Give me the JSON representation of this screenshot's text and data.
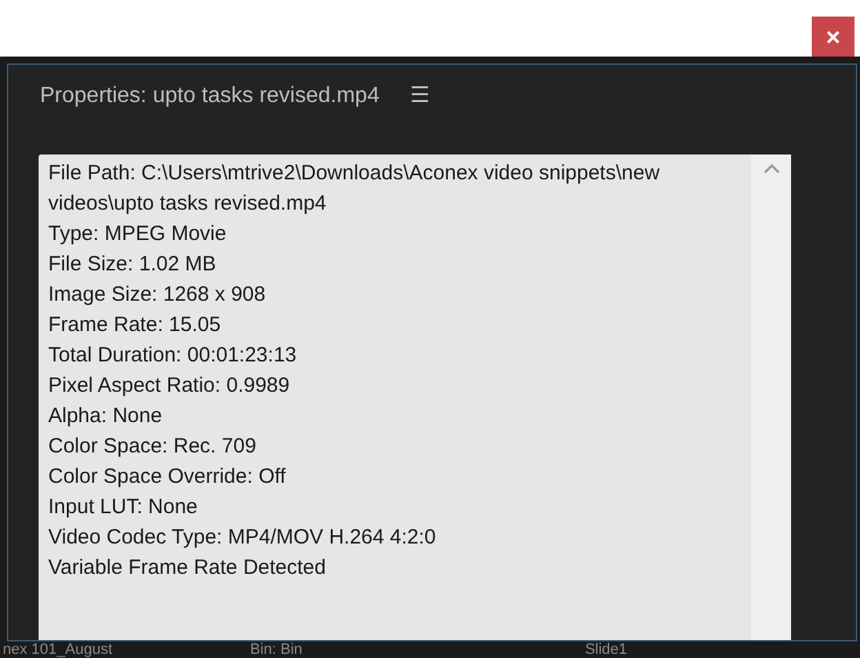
{
  "dialog": {
    "close_label": "×"
  },
  "panel": {
    "title": "Properties: upto tasks revised.mp4",
    "menu_glyph": "☰"
  },
  "properties": [
    "File Path: C:\\Users\\mtrive2\\Downloads\\Aconex video snippets\\new videos\\upto tasks revised.mp4",
    "Type: MPEG Movie",
    "File Size: 1.02 MB",
    "Image Size: 1268 x 908",
    "Frame Rate: 15.05",
    "Total Duration: 00:01:23:13",
    "Pixel Aspect Ratio: 0.9989",
    "Alpha: None",
    "Color Space: Rec. 709",
    "Color Space Override: Off",
    "Input LUT: None",
    "Video Codec Type: MP4/MOV H.264 4:2:0",
    "Variable Frame Rate Detected"
  ],
  "background_tabs": [
    "nex 101_August",
    "Bin: Bin",
    "Slide1"
  ]
}
